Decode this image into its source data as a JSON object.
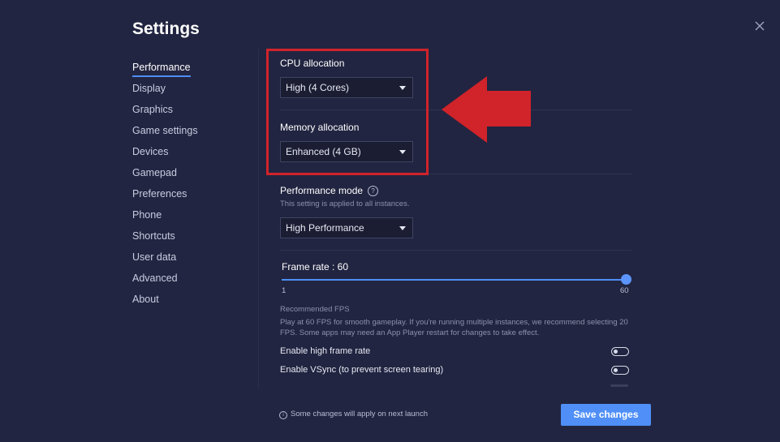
{
  "title": "Settings",
  "close_icon": "close-icon",
  "sidebar": {
    "items": [
      {
        "label": "Performance",
        "active": true
      },
      {
        "label": "Display"
      },
      {
        "label": "Graphics"
      },
      {
        "label": "Game settings"
      },
      {
        "label": "Devices"
      },
      {
        "label": "Gamepad"
      },
      {
        "label": "Preferences"
      },
      {
        "label": "Phone"
      },
      {
        "label": "Shortcuts"
      },
      {
        "label": "User data"
      },
      {
        "label": "Advanced"
      },
      {
        "label": "About"
      }
    ]
  },
  "performance": {
    "cpu": {
      "label": "CPU allocation",
      "value": "High (4 Cores)"
    },
    "memory": {
      "label": "Memory allocation",
      "value": "Enhanced (4 GB)"
    },
    "mode": {
      "label": "Performance mode",
      "help_icon": "?",
      "note": "This setting is applied to all instances.",
      "value": "High Performance"
    },
    "frame_rate": {
      "label": "Frame rate : 60",
      "min": "1",
      "max": "60",
      "value": 60
    },
    "recommended": {
      "title": "Recommended FPS",
      "text": "Play at 60 FPS for smooth gameplay. If you're running multiple instances, we recommend selecting 20 FPS. Some apps may need an App Player restart for changes to take effect."
    },
    "toggles": [
      {
        "label": "Enable high frame rate",
        "on": false
      },
      {
        "label": "Enable VSync (to prevent screen tearing)",
        "on": false
      }
    ]
  },
  "footer": {
    "info_icon": "i",
    "note": "Some changes will apply on next launch",
    "save_label": "Save changes"
  },
  "colors": {
    "background": "#222541",
    "accent": "#4f8ff7",
    "highlight": "#d0232a"
  }
}
